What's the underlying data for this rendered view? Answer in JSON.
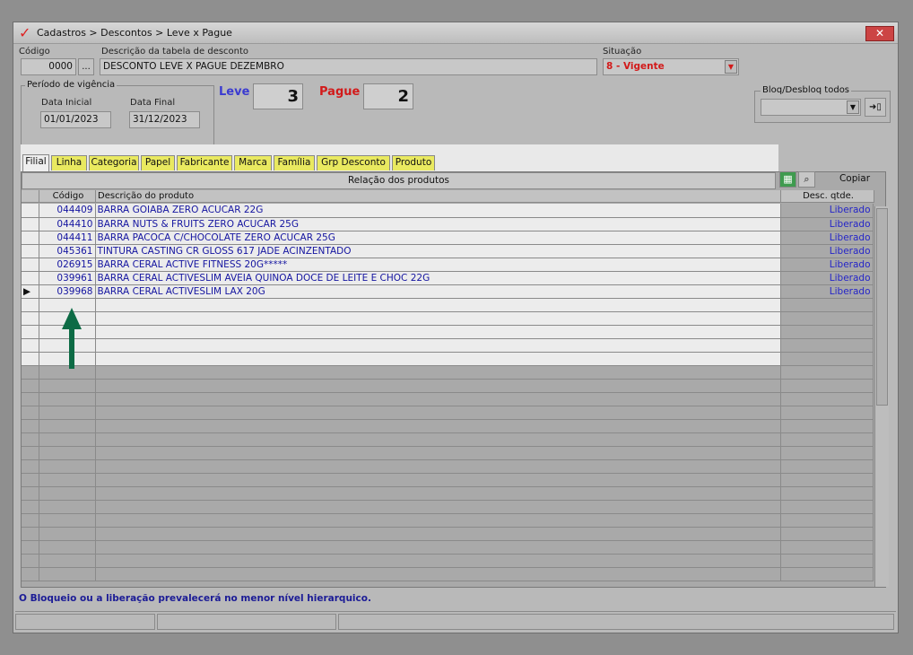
{
  "window": {
    "title": "Cadastros > Descontos > Leve x Pague",
    "close_label": "✕"
  },
  "form": {
    "codigo_label": "Código",
    "codigo_value": "0000",
    "codigo_btn": "...",
    "descricao_label": "Descrição da tabela de desconto",
    "descricao_value": "DESCONTO LEVE X PAGUE DEZEMBRO",
    "situacao_label": "Situação",
    "situacao_value": "8 - Vigente",
    "periodo_legend": "Período de vigência",
    "data_inicial_label": "Data Inicial",
    "data_inicial_value": "01/01/2023",
    "data_final_label": "Data Final",
    "data_final_value": "31/12/2023",
    "leve_label": "Leve",
    "leve_value": "3",
    "pague_label": "Pague",
    "pague_value": "2",
    "bloq_label": "Bloq/Desbloq todos",
    "bloq_value": ""
  },
  "tabs": [
    "Filial",
    "Linha",
    "Categoria",
    "Papel",
    "Fabricante",
    "Marca",
    "Família",
    "Grp Desconto",
    "Produto"
  ],
  "grid": {
    "title": "Relação dos produtos",
    "col_codigo": "Código",
    "col_descricao": "Descrição do produto",
    "col_desc_qtde": "Desc. qtde.",
    "copiar": "Copiar",
    "rows": [
      {
        "codigo": "044409",
        "descricao": "BARRA GOIABA ZERO ACUCAR 22G",
        "status": "Liberado"
      },
      {
        "codigo": "044410",
        "descricao": "BARRA NUTS & FRUITS ZERO ACUCAR 25G",
        "status": "Liberado"
      },
      {
        "codigo": "044411",
        "descricao": "BARRA PACOCA C/CHOCOLATE ZERO ACUCAR 25G",
        "status": "Liberado"
      },
      {
        "codigo": "045361",
        "descricao": "TINTURA CASTING CR GLOSS 617 JADE ACINZENTADO",
        "status": "Liberado"
      },
      {
        "codigo": "026915",
        "descricao": "BARRA CERAL ACTIVE FITNESS 20G*****",
        "status": "Liberado"
      },
      {
        "codigo": "039961",
        "descricao": "BARRA CERAL ACTIVESLIM AVEIA QUINOA DOCE DE LEITE E CHOC 22G",
        "status": "Liberado"
      },
      {
        "codigo": "039968",
        "descricao": "BARRA CERAL ACTIVESLIM LAX 20G",
        "status": "Liberado"
      }
    ]
  },
  "footer": {
    "message": "O Bloqueio ou a liberação prevalecerá no menor nível hierarquico."
  },
  "colors": {
    "accent_tab": "#e9e960",
    "link_blue": "#1414a0",
    "situacao_red": "#d21a1a",
    "arrow_green": "#0d6b45"
  },
  "icons": {
    "app": "check-icon",
    "excel": "excel-icon",
    "search": "search-icon",
    "arrow": "arrow-up-icon"
  }
}
